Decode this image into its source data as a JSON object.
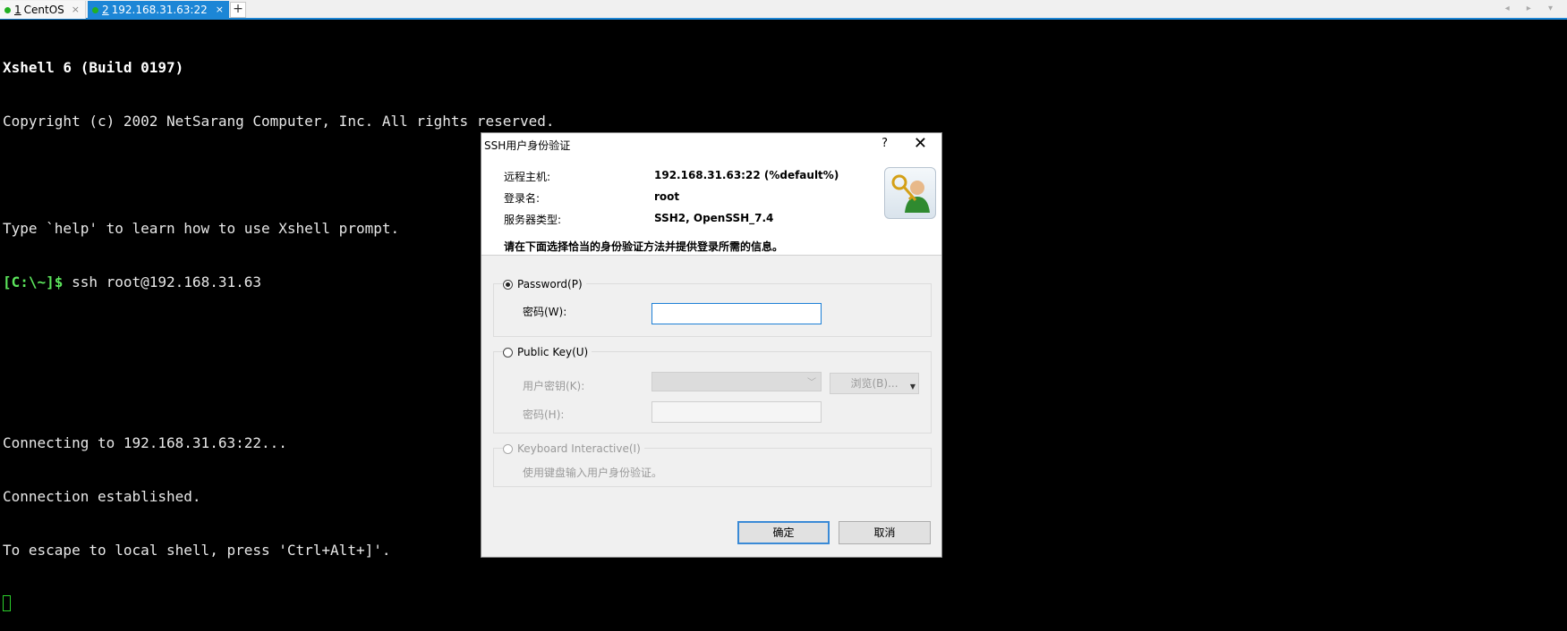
{
  "tabs": [
    {
      "num": "1",
      "label": "CentOS",
      "close": "×"
    },
    {
      "num": "2",
      "label": "192.168.31.63:22",
      "close": "×"
    }
  ],
  "add_tab": "+",
  "nav_arrows": "◂ ▸ ▾",
  "terminal": {
    "line1": "Xshell 6 (Build 0197)",
    "line2": "Copyright (c) 2002 NetSarang Computer, Inc. All rights reserved.",
    "line3": "Type `help' to learn how to use Xshell prompt.",
    "prompt": "[C:\\~]$",
    "command": " ssh root@192.168.31.63",
    "line5": "Connecting to 192.168.31.63:22...",
    "line6": "Connection established.",
    "line7": "To escape to local shell, press 'Ctrl+Alt+]'."
  },
  "dialog": {
    "title": "SSH用户身份验证",
    "help": "?",
    "close": "✕",
    "remote_host_label": "远程主机:",
    "remote_host_value": "192.168.31.63:22 (%default%)",
    "login_label": "登录名:",
    "login_value": "root",
    "server_type_label": "服务器类型:",
    "server_type_value": "SSH2, OpenSSH_7.4",
    "instruction": "请在下面选择恰当的身份验证方法并提供登录所需的信息。",
    "password_option": "Password(P)",
    "password_field_label": "密码(W):",
    "password_value": "",
    "pubkey_option": "Public Key(U)",
    "user_key_label": "用户密钥(K):",
    "user_key_value": "",
    "browse_label": "浏览(B)...",
    "passphrase_label": "密码(H):",
    "passphrase_value": "",
    "keyboard_option": "Keyboard Interactive(I)",
    "keyboard_desc": "使用键盘输入用户身份验证。",
    "ok_label": "确定",
    "cancel_label": "取消"
  },
  "colors": {
    "accent": "#1c86d6",
    "terminal_bg": "#000000",
    "prompt": "#5ce65c"
  }
}
